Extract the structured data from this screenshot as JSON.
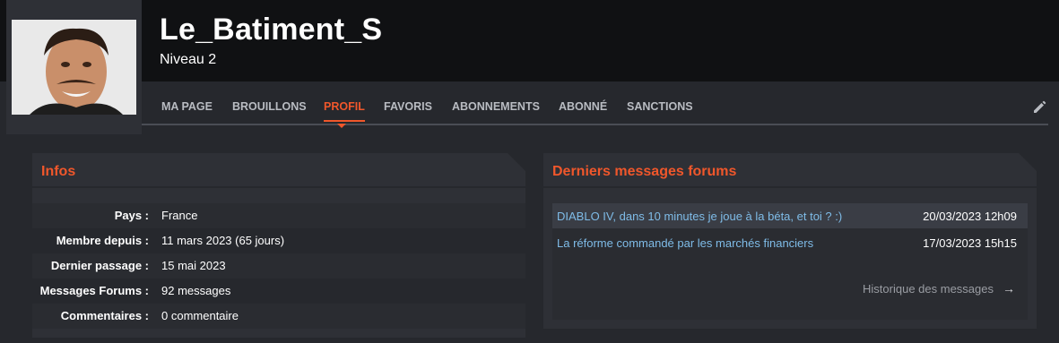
{
  "profile": {
    "username": "Le_Batiment_S",
    "level": "Niveau 2"
  },
  "nav": {
    "items": [
      {
        "label": "MA PAGE"
      },
      {
        "label": "BROUILLONS"
      },
      {
        "label": "PROFIL",
        "active": true
      },
      {
        "label": "FAVORIS"
      },
      {
        "label": "ABONNEMENTS"
      },
      {
        "label": "ABONNÉ"
      },
      {
        "label": "SANCTIONS"
      }
    ],
    "edit_icon": "pencil-icon"
  },
  "infos": {
    "title": "Infos",
    "rows": [
      {
        "label": "Pays :",
        "value": "France"
      },
      {
        "label": "Membre depuis :",
        "value": "11 mars 2023 (65 jours)"
      },
      {
        "label": "Dernier passage :",
        "value": "15 mai 2023"
      },
      {
        "label": "Messages Forums :",
        "value": "92 messages"
      },
      {
        "label": "Commentaires :",
        "value": "0 commentaire"
      }
    ]
  },
  "forums": {
    "title": "Derniers messages forums",
    "messages": [
      {
        "title": "DIABLO IV, dans 10 minutes je joue à la béta, et toi ? :)",
        "date": "20/03/2023 12h09"
      },
      {
        "title": "La réforme commandé par les marchés financiers",
        "date": "17/03/2023 15h15"
      }
    ],
    "history_label": "Historique des messages",
    "history_icon": "arrow-right-icon"
  },
  "colors": {
    "accent": "#f0572b",
    "link": "#7fbce8"
  }
}
